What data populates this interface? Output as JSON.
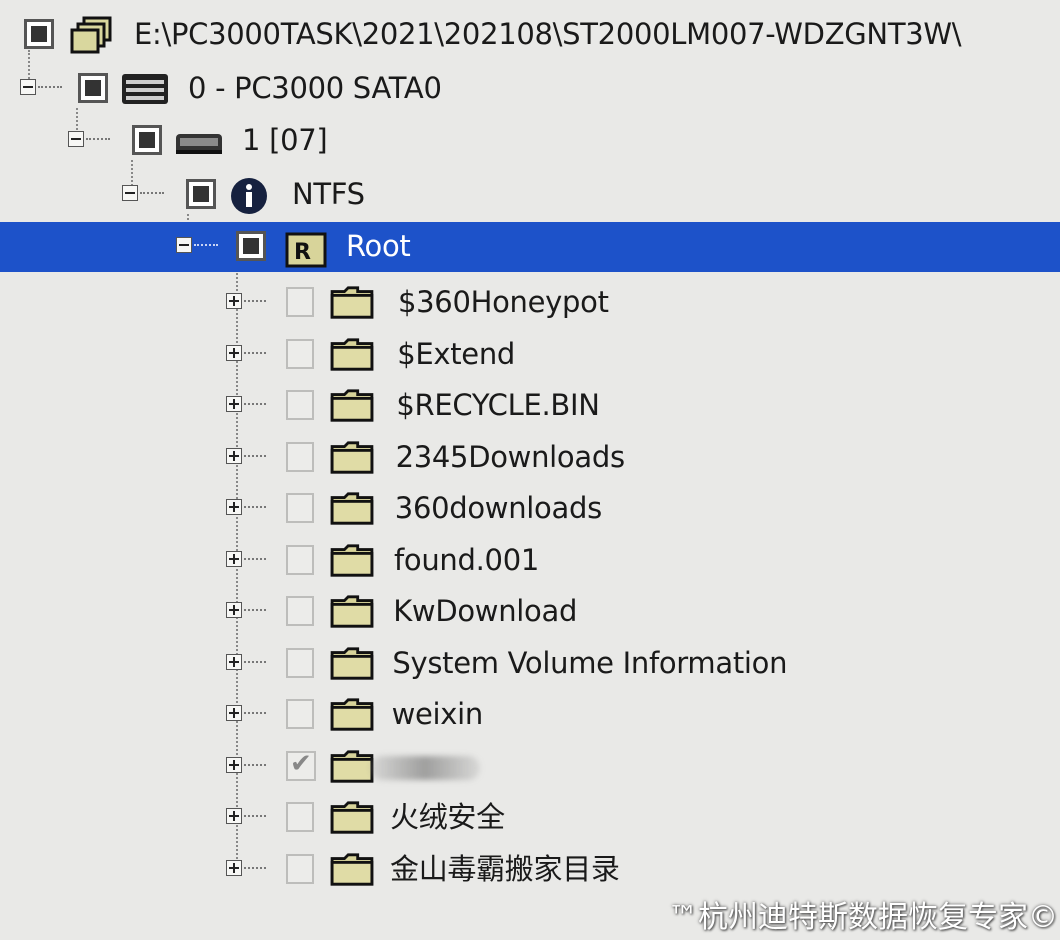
{
  "tree": {
    "path_node": {
      "label": "E:\\PC3000TASK\\2021\\202108\\ST2000LM007-WDZGNT3W\\"
    },
    "device_node": {
      "label": "0 - PC3000 SATA0"
    },
    "partition_node": {
      "label": "1 [07]"
    },
    "filesystem_node": {
      "label": "NTFS"
    },
    "root_node": {
      "label": "Root"
    },
    "folders": [
      {
        "label": "$360Honeypot",
        "checked": false
      },
      {
        "label": "$Extend",
        "checked": false
      },
      {
        "label": "$RECYCLE.BIN",
        "checked": false
      },
      {
        "label": "2345Downloads",
        "checked": false
      },
      {
        "label": "360downloads",
        "checked": false
      },
      {
        "label": "found.001",
        "checked": false
      },
      {
        "label": "KwDownload",
        "checked": false
      },
      {
        "label": "System Volume Information",
        "checked": false
      },
      {
        "label": "weixin",
        "checked": false
      },
      {
        "label": "",
        "checked": true,
        "blurred": true
      },
      {
        "label": "火绒安全",
        "checked": false
      },
      {
        "label": "金山毒霸搬家目录",
        "checked": false
      }
    ]
  },
  "watermark": {
    "text": "™杭州迪特斯数据恢复专家©"
  },
  "colors": {
    "selection": "#1d52c9",
    "background": "#e9e9e7",
    "folder": "#d8d49a"
  }
}
